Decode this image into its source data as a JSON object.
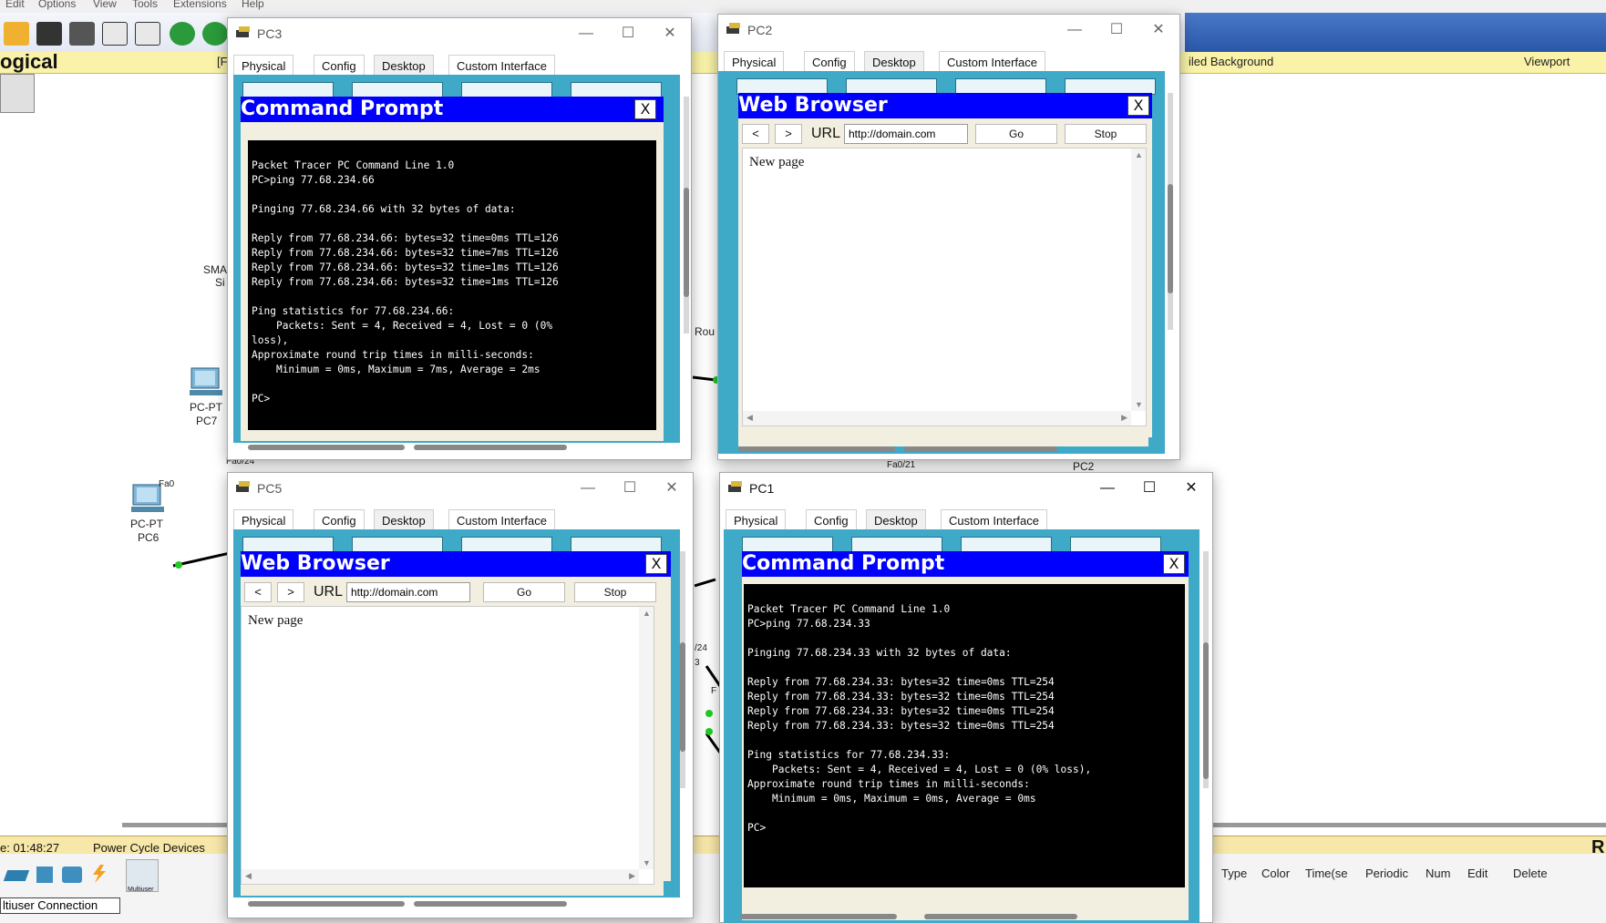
{
  "menubar": {
    "items": [
      "Edit",
      "Options",
      "View",
      "Tools",
      "Extensions",
      "Help"
    ]
  },
  "workspace": {
    "view_label": "ogical",
    "bracket_label": "[F",
    "tiled_background": "iled Background",
    "viewport": "Viewport",
    "device_labels": {
      "pc7_type": "PC-PT",
      "pc7_name": "PC7",
      "pc6_type": "PC-PT",
      "pc6_name": "PC6",
      "pc6_port": "Fa0",
      "fa024": "Fa0/24",
      "sma": "SMA",
      "si": "Si",
      "rou": "Rou",
      "fa021": "Fa0/21",
      "pc2_partial": "PC2",
      "p24": "/24",
      "p3": "3",
      "pf": "F"
    },
    "time": "e: 01:48:27",
    "power_cycle": "Power Cycle Devices",
    "r_label": "R",
    "connection_label": "ltiuser Connection",
    "multiuser_label": "Multiuser",
    "pdu_columns": [
      "Type",
      "Color",
      "Time(se",
      "Periodic",
      "Num",
      "Edit",
      "Delete"
    ]
  },
  "tabs": [
    "Physical",
    "Config",
    "Desktop",
    "Custom Interface"
  ],
  "windows": {
    "pc3": {
      "title": "PC3",
      "app_title": "Command Prompt",
      "close_x": "X",
      "terminal": "Packet Tracer PC Command Line 1.0\nPC>ping 77.68.234.66\n\nPinging 77.68.234.66 with 32 bytes of data:\n\nReply from 77.68.234.66: bytes=32 time=0ms TTL=126\nReply from 77.68.234.66: bytes=32 time=7ms TTL=126\nReply from 77.68.234.66: bytes=32 time=1ms TTL=126\nReply from 77.68.234.66: bytes=32 time=1ms TTL=126\n\nPing statistics for 77.68.234.66:\n    Packets: Sent = 4, Received = 4, Lost = 0 (0%\nloss),\nApproximate round trip times in milli-seconds:\n    Minimum = 0ms, Maximum = 7ms, Average = 2ms\n\nPC>"
    },
    "pc2": {
      "title": "PC2",
      "app_title": "Web Browser",
      "close_x": "X",
      "back": "<",
      "forward": ">",
      "url_label": "URL",
      "url": "http://domain.com",
      "go": "Go",
      "stop": "Stop",
      "page_text": "New page"
    },
    "pc5": {
      "title": "PC5",
      "app_title": "Web Browser",
      "close_x": "X",
      "back": "<",
      "forward": ">",
      "url_label": "URL",
      "url": "http://domain.com",
      "go": "Go",
      "stop": "Stop",
      "page_text": "New page"
    },
    "pc1": {
      "title": "PC1",
      "app_title": "Command Prompt",
      "close_x": "X",
      "terminal": "Packet Tracer PC Command Line 1.0\nPC>ping 77.68.234.33\n\nPinging 77.68.234.33 with 32 bytes of data:\n\nReply from 77.68.234.33: bytes=32 time=0ms TTL=254\nReply from 77.68.234.33: bytes=32 time=0ms TTL=254\nReply from 77.68.234.33: bytes=32 time=0ms TTL=254\nReply from 77.68.234.33: bytes=32 time=0ms TTL=254\n\nPing statistics for 77.68.234.33:\n    Packets: Sent = 4, Received = 4, Lost = 0 (0% loss),\nApproximate round trip times in milli-seconds:\n    Minimum = 0ms, Maximum = 0ms, Average = 0ms\n\nPC>"
    }
  },
  "colors": {
    "app_header": "#0000ff",
    "desktop_bg": "#3fa9c8",
    "logical_bar": "#f9f2a8",
    "link_green": "#22cc22"
  }
}
